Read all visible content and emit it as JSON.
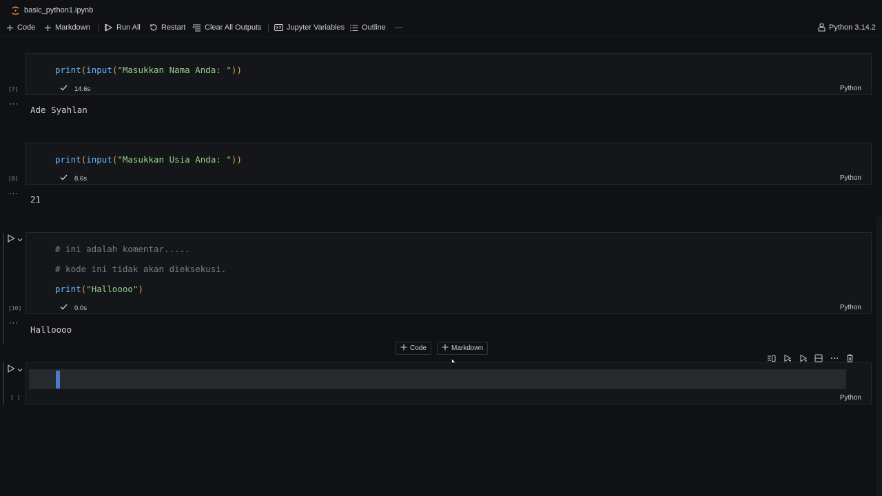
{
  "tab": {
    "filename": "basic_python1.ipynb"
  },
  "toolbar": {
    "code": "Code",
    "markdown": "Markdown",
    "run_all": "Run All",
    "restart": "Restart",
    "clear_outputs": "Clear All Outputs",
    "variables": "Jupyter Variables",
    "outline": "Outline",
    "more": "···",
    "kernel": "Python 3.14.2"
  },
  "cells": [
    {
      "code_fn1": "print",
      "code_fn2": "input",
      "code_str": "\"Masukkan Nama Anda: \"",
      "exec_count": "[7]",
      "time": "14.6s",
      "lang": "Python",
      "output": "Ade Syahlan"
    },
    {
      "code_fn1": "print",
      "code_fn2": "input",
      "code_str": "\"Masukkan Usia Anda: \"",
      "exec_count": "[8]",
      "time": "8.6s",
      "lang": "Python",
      "output": "21"
    },
    {
      "comment1": "# ini adalah komentar.....",
      "comment2": "# kode ini tidak akan dieksekusi.",
      "code_fn1": "print",
      "code_str": "\"Halloooo\"",
      "exec_count": "[10]",
      "time": "0.0s",
      "lang": "Python",
      "output": "Halloooo"
    },
    {
      "exec_count": "[ ]",
      "lang": "Python"
    }
  ],
  "output_ellipsis": "···",
  "insert": {
    "code": "Code",
    "markdown": "Markdown"
  },
  "colors": {
    "function": "#6cb6ff",
    "string": "#96d08a",
    "comment": "#7a7f86",
    "accent": "#4d78cc"
  }
}
